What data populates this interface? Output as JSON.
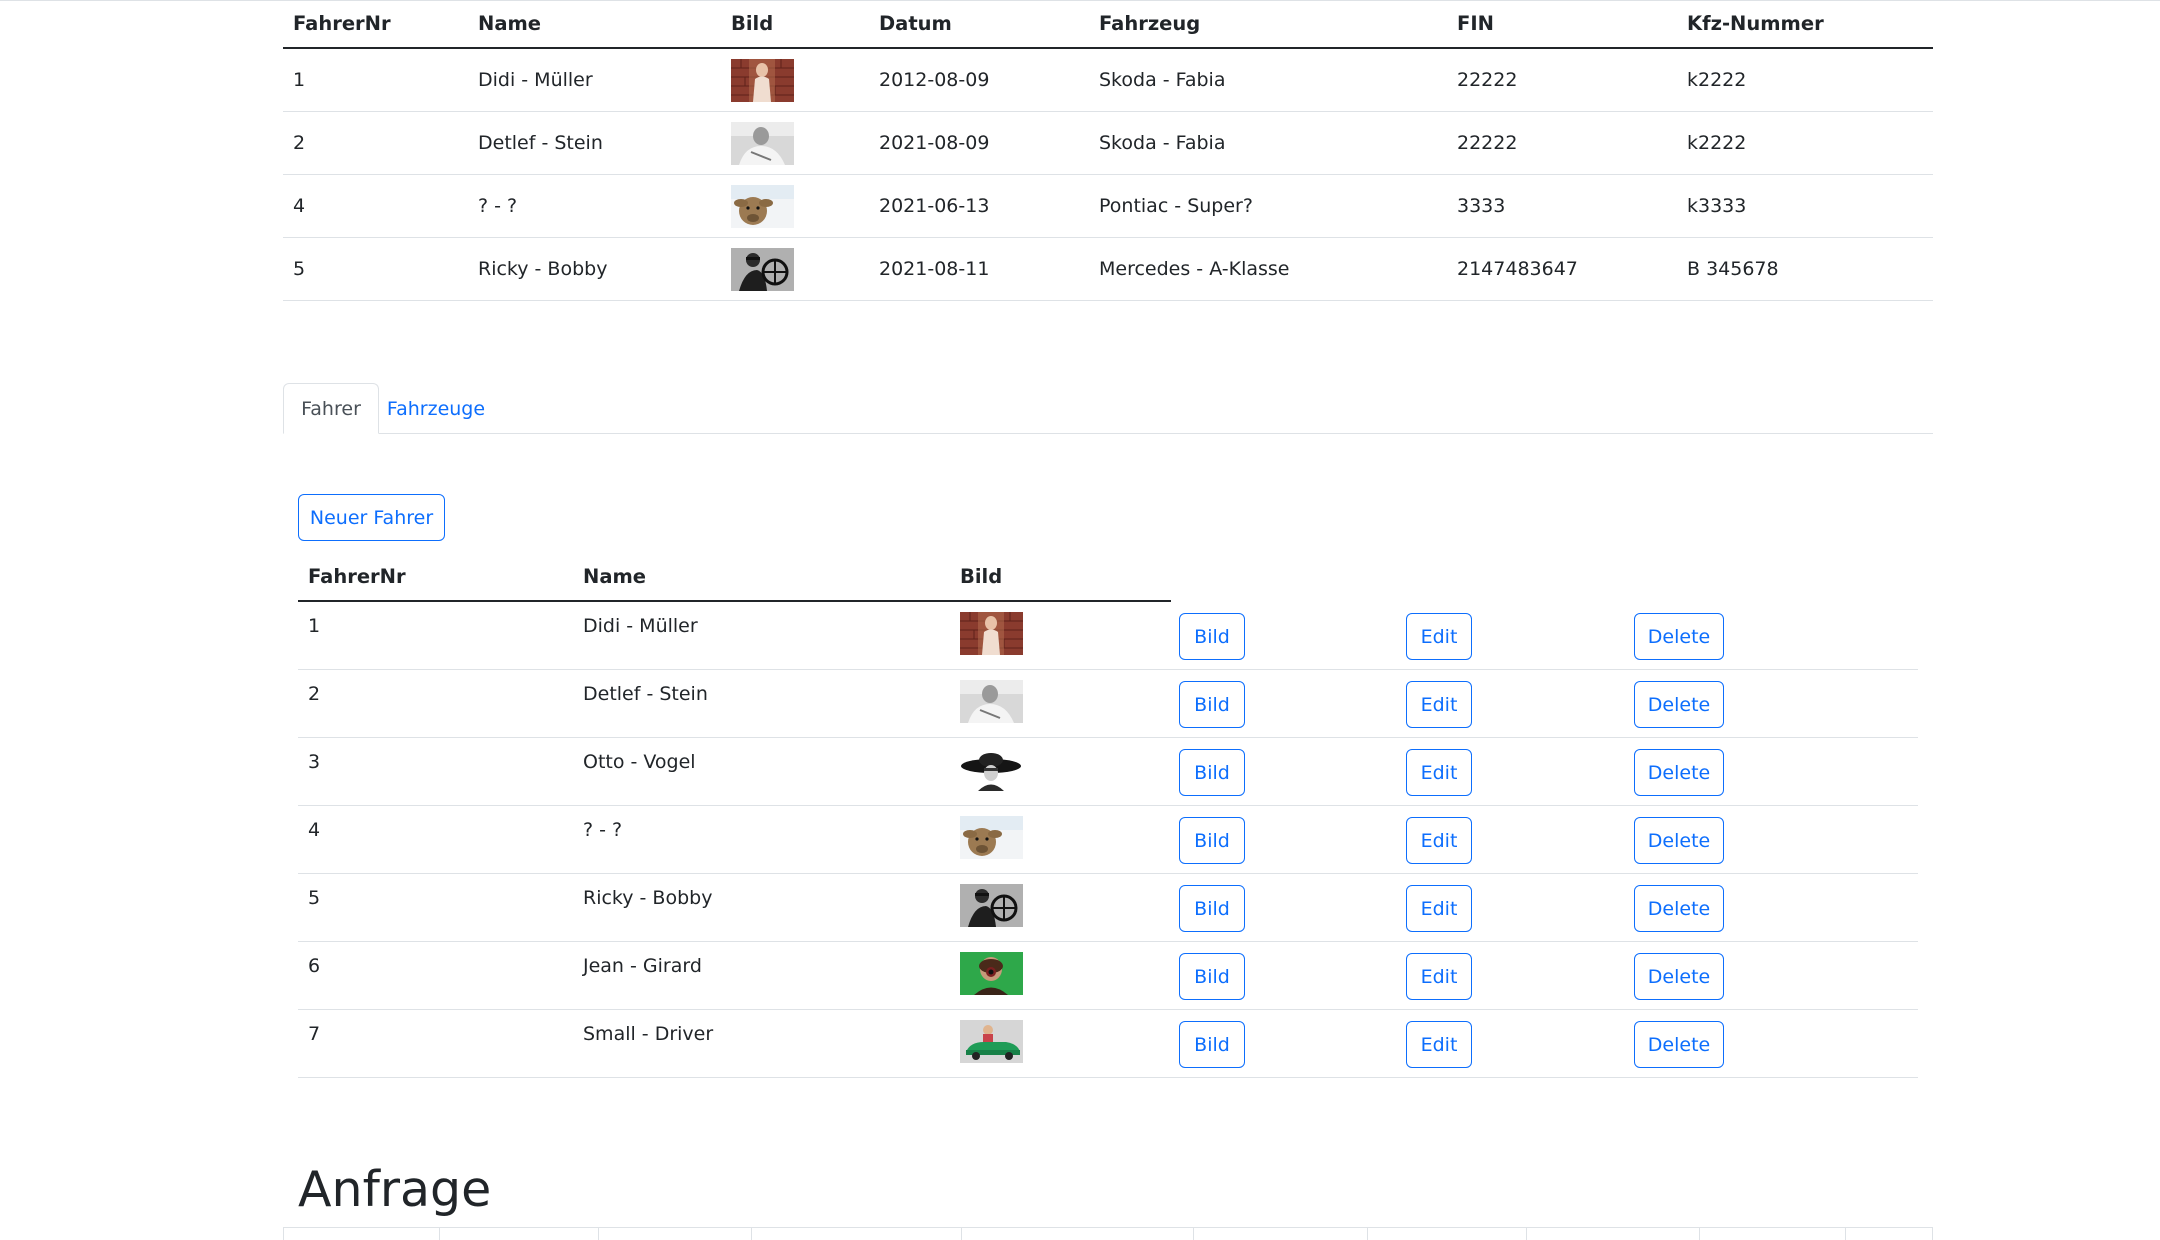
{
  "overview": {
    "headers": [
      "FahrerNr",
      "Name",
      "Bild",
      "Datum",
      "Fahrzeug",
      "FIN",
      "Kfz-Nummer"
    ],
    "rows": [
      {
        "nr": "1",
        "name": "Didi - Müller",
        "photo": "brick-wall-portrait",
        "datum": "2012-08-09",
        "fahrzeug": "Skoda - Fabia",
        "fin": "22222",
        "kfz": "k2222"
      },
      {
        "nr": "2",
        "name": "Detlef - Stein",
        "photo": "grey-portrait",
        "datum": "2021-08-09",
        "fahrzeug": "Skoda - Fabia",
        "fin": "22222",
        "kfz": "k2222"
      },
      {
        "nr": "4",
        "name": "? - ?",
        "photo": "sheep",
        "datum": "2021-06-13",
        "fahrzeug": "Pontiac - Super?",
        "fin": "3333",
        "kfz": "k3333"
      },
      {
        "nr": "5",
        "name": "Ricky - Bobby",
        "photo": "driver-steering-wheel",
        "datum": "2021-08-11",
        "fahrzeug": "Mercedes - A-Klasse",
        "fin": "2147483647",
        "kfz": "B 345678"
      }
    ]
  },
  "tabs": [
    {
      "label": "Fahrer",
      "active": true
    },
    {
      "label": "Fahrzeuge",
      "active": false
    }
  ],
  "drivers": {
    "new_button": "Neuer Fahrer",
    "headers": [
      "FahrerNr",
      "Name",
      "Bild"
    ],
    "actions": {
      "bild": "Bild",
      "edit": "Edit",
      "delete": "Delete"
    },
    "rows": [
      {
        "nr": "1",
        "name": "Didi - Müller",
        "photo": "brick-wall-portrait"
      },
      {
        "nr": "2",
        "name": "Detlef - Stein",
        "photo": "grey-portrait"
      },
      {
        "nr": "3",
        "name": "Otto - Vogel",
        "photo": "black-hat-figure"
      },
      {
        "nr": "4",
        "name": "? - ?",
        "photo": "sheep"
      },
      {
        "nr": "5",
        "name": "Ricky - Bobby",
        "photo": "driver-steering-wheel"
      },
      {
        "nr": "6",
        "name": "Jean - Girard",
        "photo": "green-screen-portrait"
      },
      {
        "nr": "7",
        "name": "Small - Driver",
        "photo": "toy-car-driver"
      }
    ]
  },
  "anfrage": {
    "title": "Anfrage"
  },
  "colors": {
    "link": "#0d6efd",
    "text": "#212529",
    "border": "#dee2e6"
  }
}
